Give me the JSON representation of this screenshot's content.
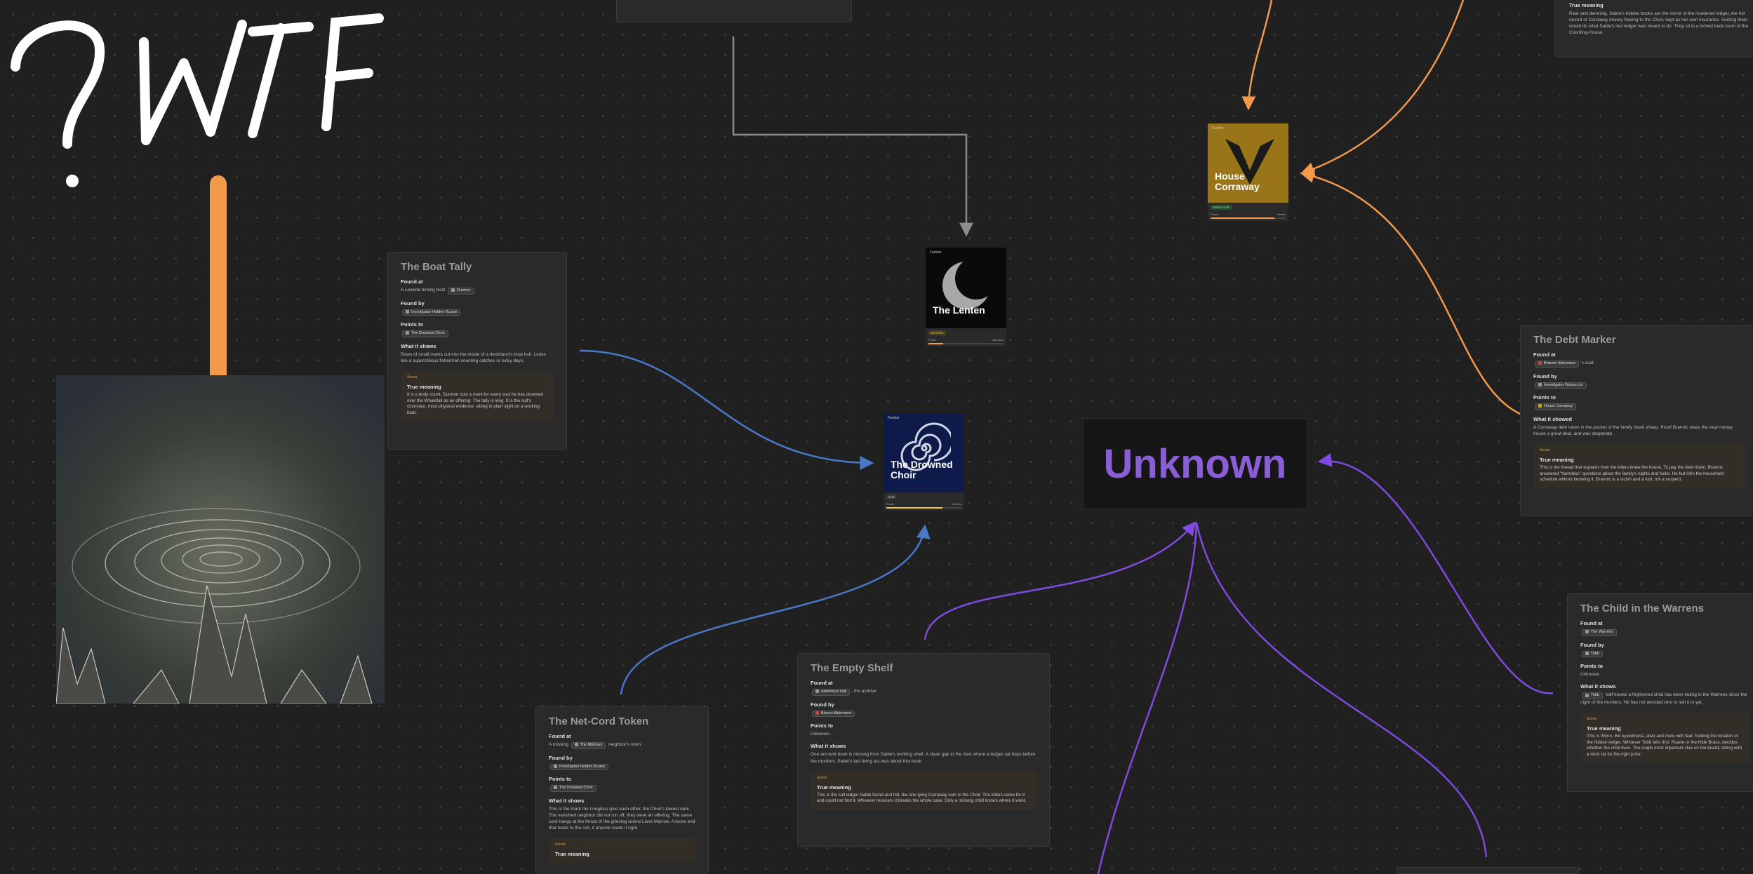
{
  "doodle": {
    "text": "?WTF"
  },
  "top_partial": {
    "label": "True meaning",
    "text": "Rear and damning. Sabre's hidden books are the mirror of the murdered ledger, the full record of Corraway money flowing to the Choir, kept as her own insurance. Seizing them would do what Sable's lost ledger was meant to do. They sit in a locked back room of the Counting-House."
  },
  "cards": {
    "boat_tally": {
      "title": "The Boat Tally",
      "found_at_label": "Found at",
      "found_at_pre": "A Lowtide fishing boat",
      "found_at_chip": "Dunmor",
      "found_by_label": "Found by",
      "found_by_chip": "Investigator Holden Ruane",
      "points_label": "Points to",
      "points_chip": "The Drowned Choir",
      "shows_label": "What it shows",
      "shows_text": "Rows of small marks cut into the inside of a deckhand's boat hull. Looks like a superstitious fisherman counting catches or lucky days.",
      "secret_tag": "Secret",
      "meaning_label": "True meaning",
      "meaning_text": "It is a body count. Dunmor cuts a mark for every soul he has drowned over the Whalefall as an offering. The tally is long. It is the cult's clumsiest, most physical evidence, sitting in plain sight on a working boat."
    },
    "debt_marker": {
      "title": "The Debt Marker",
      "found_at_label": "Found at",
      "found_at_chip": "Brannic Aldermere",
      "found_at_post": "'s coat",
      "found_by_label": "Found by",
      "found_by_chip": "Investigator Wessa Lin",
      "points_label": "Points to",
      "points_chip": "House Corraway",
      "shows_label": "What it showed",
      "shows_text": "A Corraway debt token in the pocket of the family black sheep. Proof Brannic owes the Veyl money house a great deal, and was desperate.",
      "secret_tag": "Secret",
      "meaning_label": "True meaning",
      "meaning_text": "This is the thread that explains how the killers knew the house. To pay the debt down, Brannic answered \"harmless\" questions about the family's nights and locks. He fed Orin the household schedule without knowing it. Brannic is a victim and a fool, not a suspect."
    },
    "child_warrens": {
      "title": "The Child in the Warrens",
      "found_at_label": "Found at",
      "found_at_chip": "The Warrens",
      "found_by_label": "Found by",
      "found_by_chip": "Tobb",
      "points_label": "Points to",
      "points_text": "Unknown",
      "shows_label": "What it shows",
      "shows_chip": "Tobb",
      "shows_text": " half-knows a frightened child has been hiding in the Warrens since the night of the murders. He has not decided who to sell it to yet.",
      "secret_tag": "Secret",
      "meaning_label": "True meaning",
      "meaning_text": "This is Wynn, the eyewitness, alive and mute with fear, holding the location of the hidden ledger. Whoever Tobb tells first, Ruane or the Hide Brass, decides whether the child lives. The single most important clue on the board, sitting with a dock rat for the right price."
    },
    "empty_shelf": {
      "title": "The Empty Shelf",
      "found_at_label": "Found at",
      "found_at_chip": "Aldermere Hall",
      "found_at_post": ", the archive",
      "found_by_label": "Found by",
      "found_by_chip": "Blanca Aldermere",
      "points_label": "Points to",
      "points_text": "Unknown",
      "shows_label": "What it shows",
      "shows_text": "One account book is missing from Sable's working shelf. A clean gap in the dust where a ledger sat days before the murders. Sable's last living act was about this book.",
      "secret_tag": "Secret",
      "meaning_label": "True meaning",
      "meaning_text": "This is the cult ledger Sable found and hid, the one tying Corraway coin to the Choir. The killers came for it and could not find it. Whoever recovers it breaks the whole case. Only a missing child knows where it went."
    },
    "net_cord": {
      "title": "The Net-Cord Token",
      "found_at_label": "Found at",
      "found_at_pre": "A missing",
      "found_at_chip": "The Midrows",
      "found_at_post": "neighbor's room",
      "found_by_label": "Found by",
      "found_by_chip": "Investigator Holden Ruane",
      "points_label": "Points to",
      "points_chip": "The Drowned Choir",
      "shows_label": "What it shows",
      "shows_text": "This is the mark the Longless give each other, the Choir's lowest rank. The vanished neighbor did not run off, they were an offering. The same cord hangs at the throat of the grieving widow Lisse Marrow. A loose end that leads to the cult, if anyone reads it right.",
      "secret_tag": "Secret",
      "meaning_label": "True meaning"
    }
  },
  "tiles": {
    "corraway": {
      "label": "Faction",
      "name_line1": "House",
      "name_line2": "Corraway",
      "badge": "Status Ruler",
      "meta_left": "Power",
      "meta_right": "Wealth"
    },
    "lenten": {
      "label": "Faction",
      "name": "The Lenten",
      "badge": "Secretive",
      "meta_left": "Power",
      "meta_right": "Unknown"
    },
    "choir": {
      "label": "Faction",
      "name_line1": "The Drowned",
      "name_line2": "Choir",
      "badge": "Cult",
      "meta_left": "Power",
      "meta_right": "Hidden"
    }
  },
  "unknown_label": "Unknown",
  "colors": {
    "orange": "#f2994a",
    "blue": "#4a78c8",
    "purple": "#7e4ae0",
    "gray": "#8c8c8c"
  }
}
